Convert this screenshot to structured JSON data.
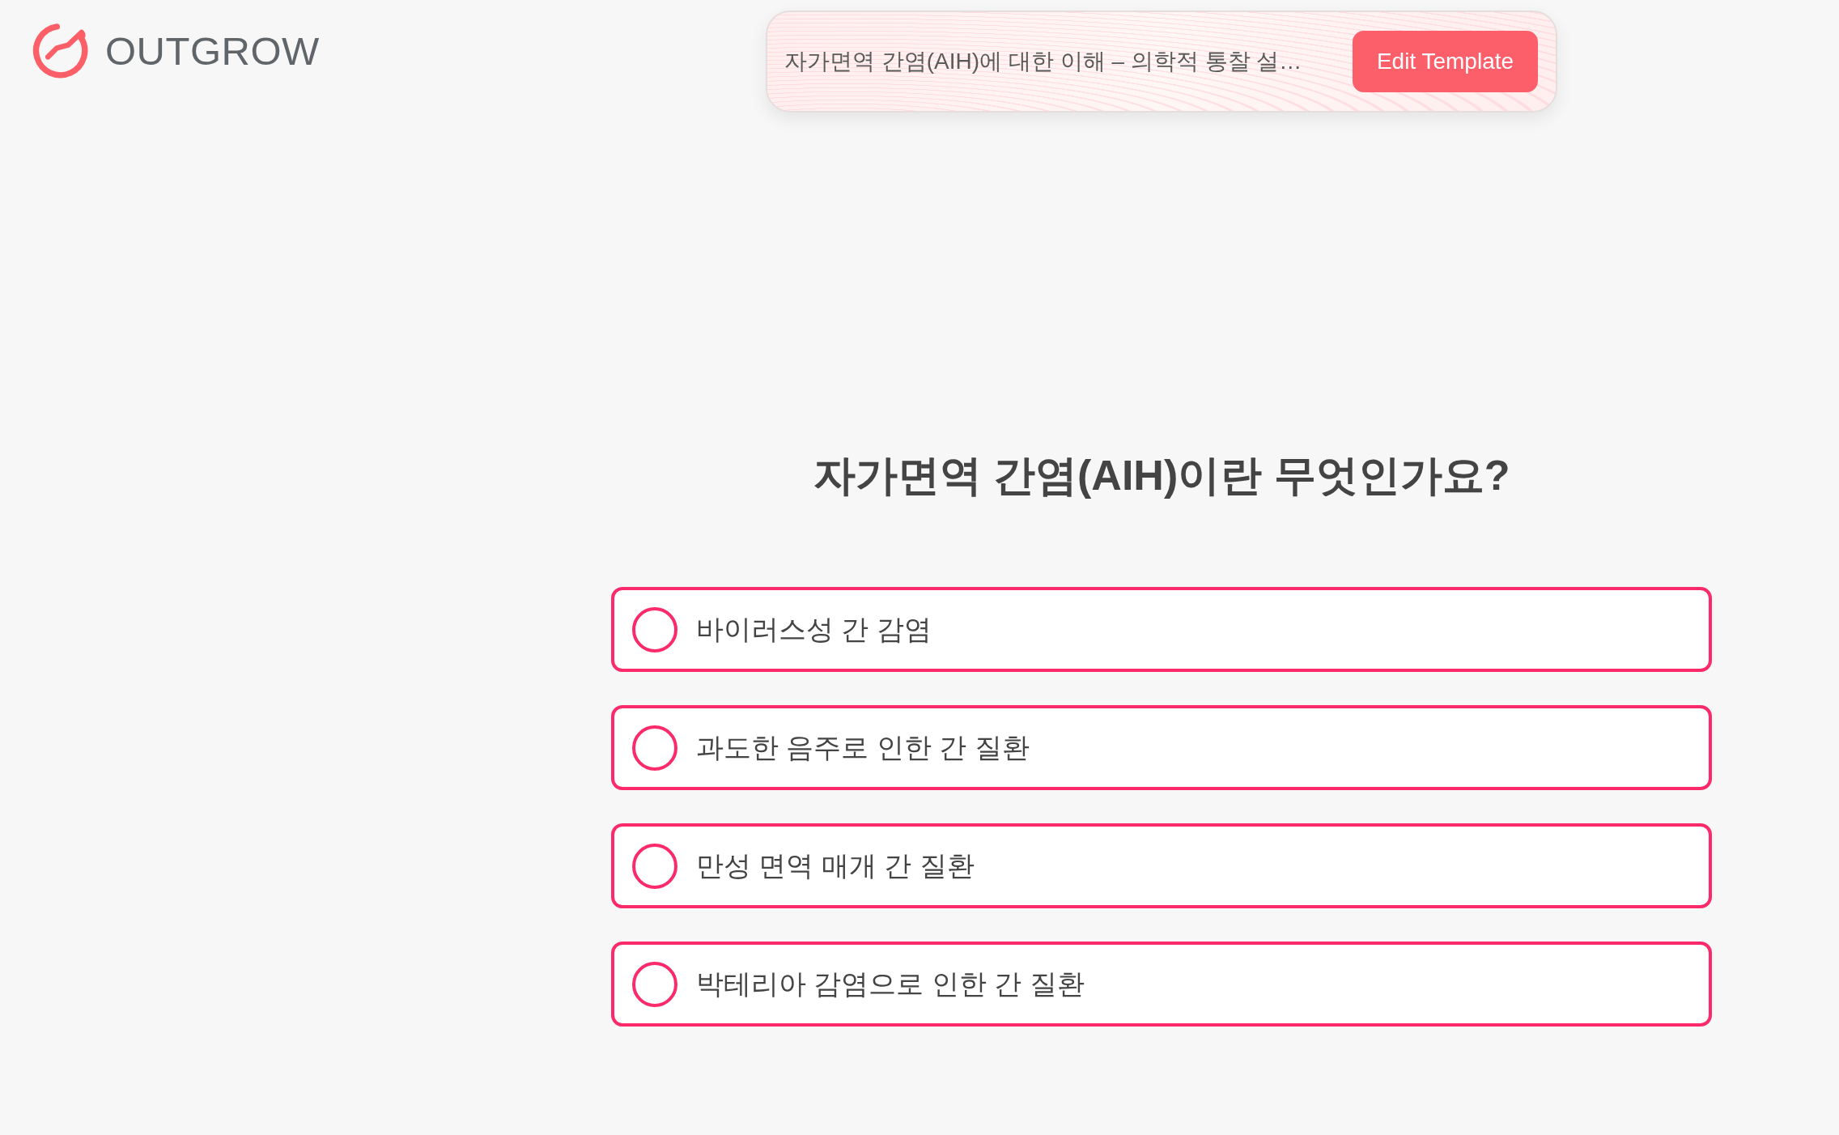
{
  "logo": {
    "text": "OUTGROW"
  },
  "template_bar": {
    "title": "자가면역 간염(AIH)에 대한 이해 – 의학적 통찰 설…",
    "button": "Edit Template"
  },
  "question": {
    "title": "자가면역 간염(AIH)이란 무엇인가요?",
    "options": [
      {
        "label": "바이러스성 간 감염",
        "selected": false
      },
      {
        "label": "과도한 음주로 인한 간 질환",
        "selected": false
      },
      {
        "label": "만성 면역 매개 간 질환",
        "selected": false
      },
      {
        "label": "박테리아 감염으로 인한 간 질환",
        "selected": false
      }
    ]
  }
}
